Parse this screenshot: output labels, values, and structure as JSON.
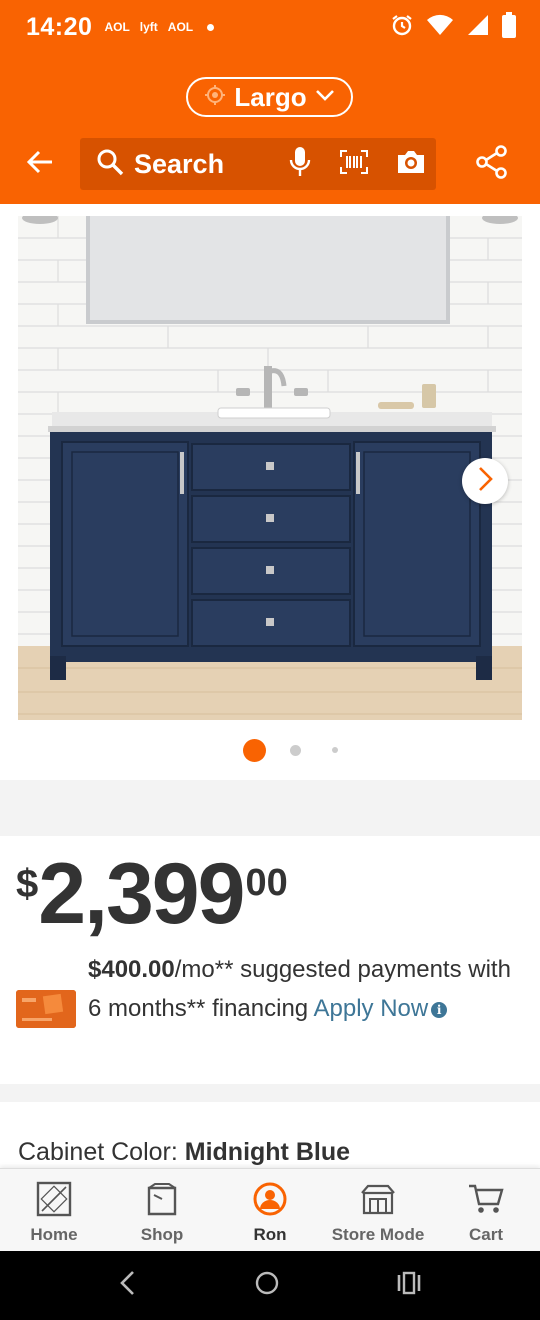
{
  "status_bar": {
    "time": "14:20",
    "apps": [
      "AOL",
      "lyft",
      "AOL"
    ]
  },
  "header": {
    "store_name": "Largo",
    "search_label": "Search",
    "icons": [
      "back-arrow-icon",
      "location-icon",
      "chevron-down-icon",
      "search-icon",
      "microphone-icon",
      "barcode-icon",
      "camera-icon",
      "share-icon"
    ]
  },
  "gallery": {
    "image_description": "Navy blue bathroom vanity with white marble top",
    "slide_count": 3,
    "active_slide": 1
  },
  "price": {
    "currency": "$",
    "dollars": "2,399",
    "cents": "00"
  },
  "financing": {
    "amount": "$400.00",
    "text_before": "/mo** suggested payments with 6 months** financing ",
    "apply_label": "Apply Now"
  },
  "options": {
    "label": "Cabinet Color: ",
    "value": "Midnight Blue"
  },
  "bottom_nav": {
    "items": [
      {
        "label": "Home"
      },
      {
        "label": "Shop"
      },
      {
        "label": "Ron"
      },
      {
        "label": "Store Mode"
      },
      {
        "label": "Cart"
      }
    ]
  },
  "colors": {
    "brand_orange": "#f96302",
    "link_blue": "#3e7697",
    "vanity_blue": "#233452"
  }
}
